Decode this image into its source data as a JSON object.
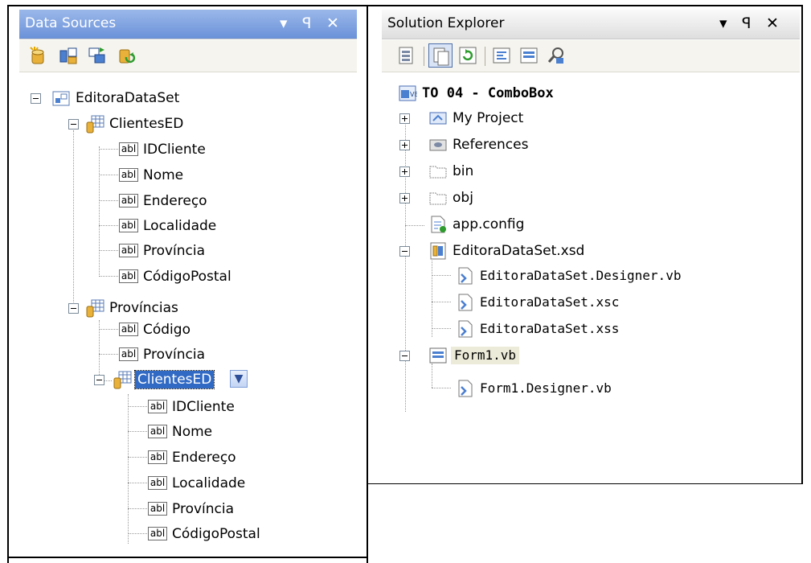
{
  "colors": {
    "title_blue": "#7a9de0",
    "selection": "#316ac5",
    "toolbar_bg": "#f5f4ee"
  },
  "data_sources": {
    "title": "Data Sources",
    "controls": {
      "dropdown": "▾",
      "pin": "ꟼ",
      "close": "✕"
    },
    "toolbar": [
      "add-data-source-icon",
      "edit-dataset-designer-icon",
      "configure-dataset-icon",
      "refresh-icon"
    ],
    "root": "EditoraDataSet",
    "tables": [
      {
        "name": "ClientesED",
        "fields": [
          "IDCliente",
          "Nome",
          "Endereço",
          "Localidade",
          "Província",
          "CódigoPostal"
        ]
      },
      {
        "name": "Províncias",
        "fields": [
          "Código",
          "Província"
        ]
      }
    ],
    "nested": {
      "name": "ClientesED",
      "fields": [
        "IDCliente",
        "Nome",
        "Endereço",
        "Localidade",
        "Província",
        "CódigoPostal"
      ]
    },
    "field_icon_text": "abl"
  },
  "solution_explorer": {
    "title": "Solution Explorer",
    "controls": {
      "dropdown": "▾",
      "pin": "ꟼ",
      "close": "✕"
    },
    "toolbar": [
      "properties-icon",
      "show-all-files-icon",
      "refresh-icon",
      "view-code-icon",
      "view-designer-icon",
      "class-diagram-icon"
    ],
    "project": "TO 04 - ComboBox",
    "items": [
      {
        "label": "My Project"
      },
      {
        "label": "References"
      },
      {
        "label": "bin"
      },
      {
        "label": "obj"
      },
      {
        "label": "app.config"
      },
      {
        "label": "EditoraDataSet.xsd"
      },
      {
        "label": "EditoraDataSet.Designer.vb"
      },
      {
        "label": "EditoraDataSet.xsc"
      },
      {
        "label": "EditoraDataSet.xss"
      },
      {
        "label": "Form1.vb"
      },
      {
        "label": "Form1.Designer.vb"
      }
    ]
  }
}
